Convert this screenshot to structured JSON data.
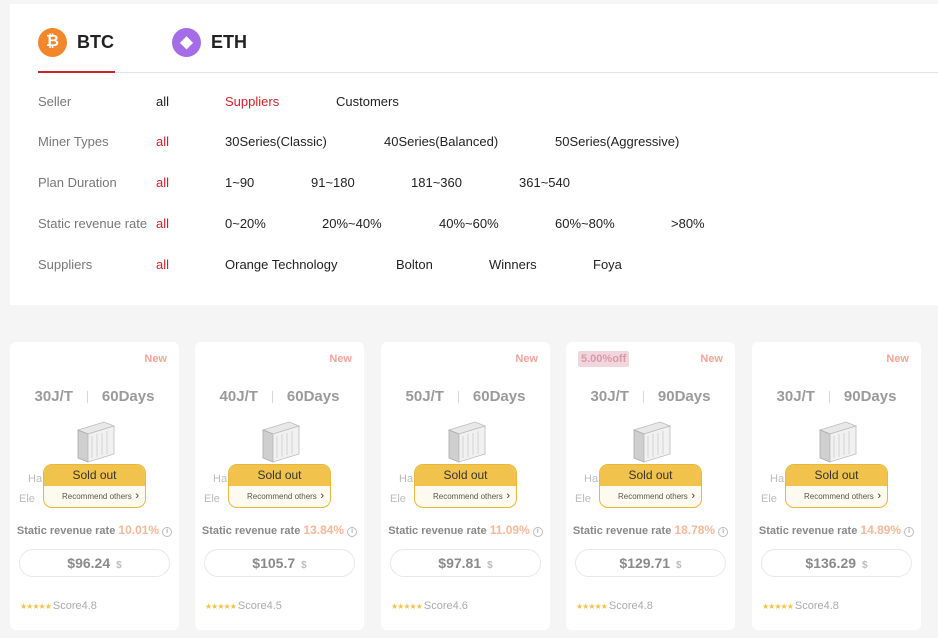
{
  "coins": {
    "btc": {
      "label": "BTC",
      "symbol": "₿"
    },
    "eth": {
      "label": "ETH",
      "symbol": "◆"
    }
  },
  "filters": [
    {
      "label": "Seller",
      "options": [
        "all",
        "Suppliers",
        "Customers"
      ],
      "active": 1
    },
    {
      "label": "Miner Types",
      "options": [
        "all",
        "30Series(Classic)",
        "40Series(Balanced)",
        "50Series(Aggressive)"
      ],
      "active": 0
    },
    {
      "label": "Plan Duration",
      "options": [
        "all",
        "1~90",
        "91~180",
        "181~360",
        "361~540"
      ],
      "active": 0
    },
    {
      "label": "Static revenue rate",
      "options": [
        "all",
        "0~20%",
        "20%~40%",
        "40%~60%",
        "60%~80%",
        ">80%"
      ],
      "active": 0
    },
    {
      "label": "Suppliers",
      "options": [
        "all",
        "Orange Technology",
        "Bolton",
        "Winners",
        "Foya"
      ],
      "active": 0
    }
  ],
  "common": {
    "new_badge": "New",
    "sold_out": "Sold out",
    "recommend": "Recommend others",
    "rate_label": "Static revenue rate",
    "currency": "$",
    "ghost1": "Ha",
    "ghost2": "Ele",
    "score_prefix": "Score"
  },
  "products": [
    {
      "efficiency": "30J/T",
      "days": "60Days",
      "rate": "10.01%",
      "price": "$96.24",
      "score": "4.8",
      "stars": 5,
      "discount": ""
    },
    {
      "efficiency": "40J/T",
      "days": "60Days",
      "rate": "13.84%",
      "price": "$105.7",
      "score": "4.5",
      "stars": 5,
      "discount": ""
    },
    {
      "efficiency": "50J/T",
      "days": "60Days",
      "rate": "11.09%",
      "price": "$97.81",
      "score": "4.6",
      "stars": 5,
      "discount": ""
    },
    {
      "efficiency": "30J/T",
      "days": "90Days",
      "rate": "18.78%",
      "price": "$129.71",
      "score": "4.8",
      "stars": 5,
      "discount": "5.00%off"
    },
    {
      "efficiency": "30J/T",
      "days": "90Days",
      "rate": "14.89%",
      "price": "$136.29",
      "score": "4.8",
      "stars": 4.5,
      "discount": ""
    }
  ],
  "colors": {
    "accent": "#d0202a",
    "btc": "#f2862a",
    "eth": "#a46ce6",
    "sold_out": "#f1c34c"
  }
}
